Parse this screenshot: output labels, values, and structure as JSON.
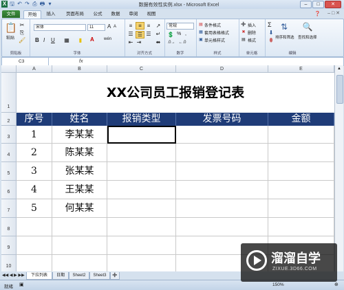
{
  "window": {
    "title": "数据有效性实例.xlsx - Microsoft Excel"
  },
  "tabs": [
    "文件",
    "开始",
    "插入",
    "页面布局",
    "公式",
    "数据",
    "审阅",
    "视图"
  ],
  "ribbon": {
    "clipboard": {
      "paste": "粘贴",
      "label": "剪贴板"
    },
    "font": {
      "name": "宋体",
      "size": "11",
      "label": "字体",
      "A_large": "A",
      "A_small": "A",
      "bold": "B",
      "italic": "I",
      "underline": "U",
      "wen": "wén"
    },
    "alignment": {
      "label": "对齐方式"
    },
    "number": {
      "format": "常规",
      "label": "数字",
      "percent": "%",
      "comma": ","
    },
    "styles": {
      "cond": "条件格式",
      "table": "套用表格格式",
      "cell": "单元格样式",
      "label": "样式"
    },
    "cells": {
      "insert": "插入",
      "delete": "删除",
      "format": "格式",
      "label": "单元格"
    },
    "editing": {
      "sum": "Σ",
      "sort": "排序和筛选",
      "find": "查找和选择",
      "label": "编辑"
    }
  },
  "formula_bar": {
    "name_box": "C3",
    "fx": "fx",
    "value": ""
  },
  "columns": [
    "A",
    "B",
    "C",
    "D",
    "E"
  ],
  "rows": [
    "1",
    "2",
    "3",
    "4",
    "5",
    "6",
    "7",
    "8",
    "9",
    "10"
  ],
  "sheet_title": "XX公司员工报销登记表",
  "table_headers": [
    "序号",
    "姓名",
    "报销类型",
    "发票号码",
    "金额"
  ],
  "table_rows": [
    [
      "1",
      "李某某",
      "",
      "",
      ""
    ],
    [
      "2",
      "陈某某",
      "",
      "",
      ""
    ],
    [
      "3",
      "张某某",
      "",
      "",
      ""
    ],
    [
      "4",
      "王某某",
      "",
      "",
      ""
    ],
    [
      "5",
      "何某某",
      "",
      "",
      ""
    ],
    [
      "",
      "",
      "",
      "",
      ""
    ],
    [
      "",
      "",
      "",
      "",
      ""
    ],
    [
      "",
      "",
      "",
      "",
      ""
    ]
  ],
  "sheet_tabs": [
    "下拉列表",
    "日期",
    "Sheet2",
    "Sheet3"
  ],
  "status": {
    "ready": "就绪",
    "zoom": "150%"
  },
  "watermark": {
    "brand": "溜溜自学",
    "url": "ZIXUE.3D66.COM"
  },
  "colors": {
    "header_fill": "#1f3c78",
    "file_tab": "#2a6e2a"
  }
}
